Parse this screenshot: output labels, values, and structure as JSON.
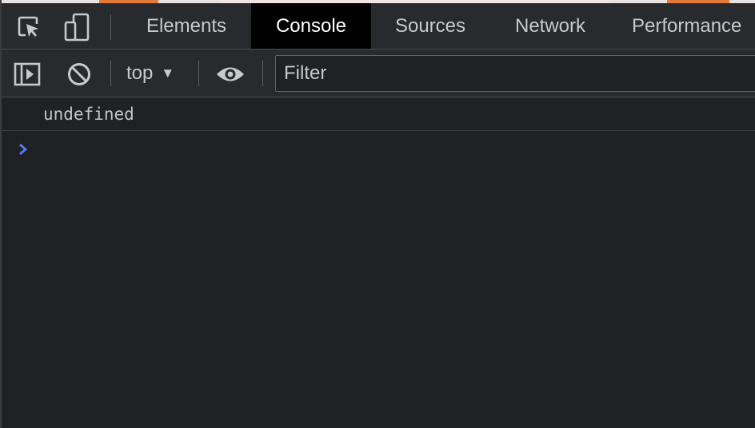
{
  "tabs": [
    {
      "label": "Elements",
      "active": false
    },
    {
      "label": "Console",
      "active": true
    },
    {
      "label": "Sources",
      "active": false
    },
    {
      "label": "Network",
      "active": false
    },
    {
      "label": "Performance",
      "active": false
    }
  ],
  "toolbar": {
    "context_label": "top",
    "filter_placeholder": "Filter"
  },
  "console": {
    "messages": [
      "undefined"
    ]
  },
  "icons": {
    "inspect": "inspect-element-icon",
    "device": "device-toolbar-icon",
    "sidebar": "show-sidebar-icon",
    "clear": "clear-console-icon",
    "live_expression": "eye-icon",
    "prompt": "chevron-right-icon"
  },
  "colors": {
    "background": "#202124",
    "toolbar": "#292a2d",
    "active_tab": "#000000",
    "text": "#c6c9ce",
    "prompt": "#4d7ef7",
    "accent_orange": "#e37b39"
  }
}
